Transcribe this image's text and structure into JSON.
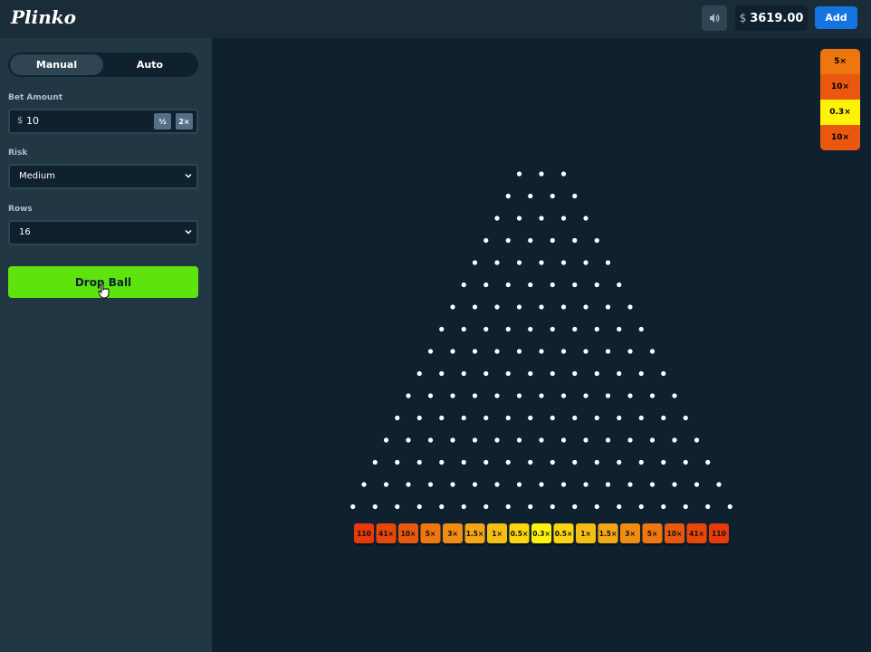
{
  "header": {
    "logo": "Plinko",
    "balance_currency": "$",
    "balance": "3619.00",
    "add_label": "Add"
  },
  "sidebar": {
    "tabs": [
      {
        "label": "Manual",
        "active": true
      },
      {
        "label": "Auto",
        "active": false
      }
    ],
    "bet_label": "Bet Amount",
    "bet_currency": "$",
    "bet_value": "10",
    "half_label": "½",
    "double_label": "2×",
    "risk_label": "Risk",
    "risk_value": "Medium",
    "rows_label": "Rows",
    "rows_value": "16",
    "drop_label": "Drop Ball"
  },
  "board": {
    "rows": 16,
    "multipliers": [
      "110",
      "41×",
      "10×",
      "5×",
      "3×",
      "1.5×",
      "1×",
      "0.5×",
      "0.3×",
      "0.5×",
      "1×",
      "1.5×",
      "3×",
      "5×",
      "10×",
      "41×",
      "110"
    ],
    "multiplier_colors": [
      "#e8390a",
      "#e8470a",
      "#ea5810",
      "#ee760f",
      "#f08c12",
      "#f4a615",
      "#f6bd14",
      "#fbd50f",
      "#fff20a",
      "#fbd50f",
      "#f6bd14",
      "#f4a615",
      "#f08c12",
      "#ee760f",
      "#ea5810",
      "#e8470a",
      "#e8390a"
    ]
  },
  "history": [
    {
      "label": "5×",
      "color": "#ee760f"
    },
    {
      "label": "10×",
      "color": "#ea5810"
    },
    {
      "label": "0.3×",
      "color": "#fff20a"
    },
    {
      "label": "10×",
      "color": "#ea5810"
    }
  ],
  "colors": {
    "background": "#0f212e",
    "sidebar": "#213743",
    "accent_green": "#5ee30c",
    "accent_blue": "#1475e1",
    "peg": "#ffffff"
  },
  "icons": {
    "sound": "speaker-icon",
    "select": "chevron-down-icon",
    "cursor": "hand-pointer-icon"
  }
}
